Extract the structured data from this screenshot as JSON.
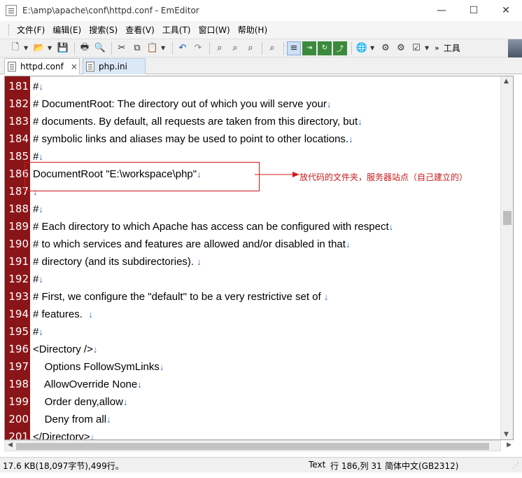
{
  "window": {
    "title": "E:\\amp\\apache\\conf\\httpd.conf - EmEditor",
    "minimize": "—",
    "maximize": "☐",
    "close": "✕"
  },
  "menu": {
    "items": [
      {
        "label": "文件(F)"
      },
      {
        "label": "编辑(E)"
      },
      {
        "label": "搜索(S)"
      },
      {
        "label": "查看(V)"
      },
      {
        "label": "工具(T)"
      },
      {
        "label": "窗口(W)"
      },
      {
        "label": "帮助(H)"
      }
    ]
  },
  "toolbar": {
    "overflow": "»",
    "tools_label": "工具"
  },
  "tabs": [
    {
      "label": "httpd.conf",
      "active": true,
      "close": "×"
    },
    {
      "label": "php.ini",
      "active": false
    }
  ],
  "editor": {
    "eol_mark": "↓",
    "lines": [
      {
        "num": "181",
        "text": "#"
      },
      {
        "num": "182",
        "text": "# DocumentRoot: The directory out of which you will serve your"
      },
      {
        "num": "183",
        "text": "# documents. By default, all requests are taken from this directory, but"
      },
      {
        "num": "184",
        "text": "# symbolic links and aliases may be used to point to other locations."
      },
      {
        "num": "185",
        "text": "#"
      },
      {
        "num": "186",
        "text": "DocumentRoot \"E:\\workspace\\php\""
      },
      {
        "num": "187",
        "text": ""
      },
      {
        "num": "188",
        "text": "#"
      },
      {
        "num": "189",
        "text": "# Each directory to which Apache has access can be configured with respect"
      },
      {
        "num": "190",
        "text": "# to which services and features are allowed and/or disabled in that"
      },
      {
        "num": "191",
        "text": "# directory (and its subdirectories). "
      },
      {
        "num": "192",
        "text": "#"
      },
      {
        "num": "193",
        "text": "# First, we configure the \"default\" to be a very restrictive set of "
      },
      {
        "num": "194",
        "text": "# features.  "
      },
      {
        "num": "195",
        "text": "#"
      },
      {
        "num": "196",
        "text": "<Directory />"
      },
      {
        "num": "197",
        "text": "    Options FollowSymLinks"
      },
      {
        "num": "198",
        "text": "    AllowOverride None"
      },
      {
        "num": "199",
        "text": "    Order deny,allow"
      },
      {
        "num": "200",
        "text": "    Deny from all"
      },
      {
        "num": "201",
        "text": "</Directory>"
      }
    ]
  },
  "annotation": {
    "text": "放代码的文件夹，服务器站点（自己建立的）",
    "color": "#c81a1a"
  },
  "status": {
    "file_info": "17.6 KB(18,097字节),499行。",
    "mode": "Text",
    "position": "行 186,列 31",
    "encoding": "简体中文(GB2312)"
  },
  "colors": {
    "gutter": "#8a1518",
    "eol": "#2a6fc7"
  }
}
